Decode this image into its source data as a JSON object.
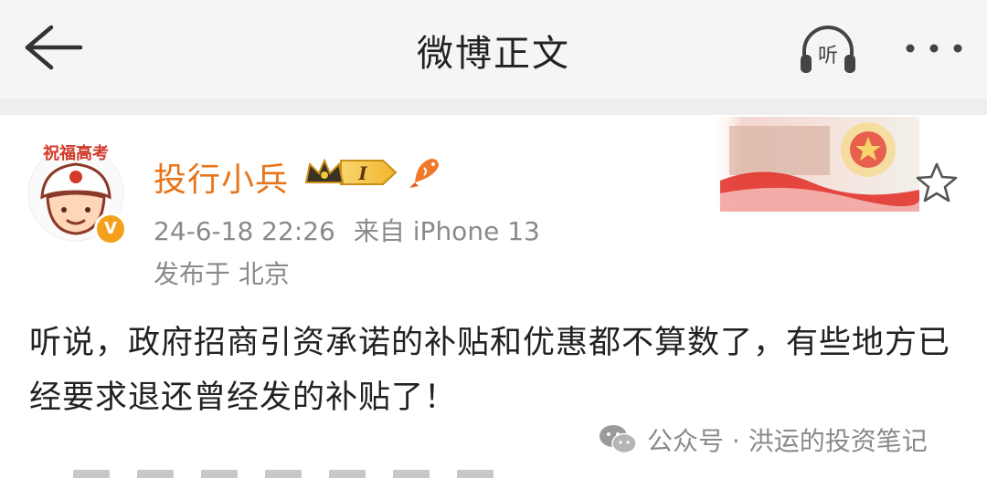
{
  "header": {
    "title": "微博正文",
    "listen_label": "听"
  },
  "post": {
    "author": {
      "name": "投行小兵",
      "avatar_caption": "祝福高考",
      "verified_badge": "V",
      "member_level": "I"
    },
    "timestamp": "24-6-18 22:26",
    "source": "来自 iPhone 13",
    "location": "发布于 北京",
    "content": "听说，政府招商引资承诺的补贴和优惠都不算数了，有些地方已经要求退还曾经发的补贴了！"
  },
  "watermark": {
    "text": "公众号 · 洪运的投资笔记"
  },
  "colors": {
    "username": "#e8741a",
    "meta": "#8a8a8a",
    "topbar_bg": "#f5f5f5",
    "badge_gold": "#f4a01c"
  },
  "icons": {
    "back": "back-arrow-icon",
    "listen": "headphones-icon",
    "more": "more-dots-icon",
    "star": "star-icon",
    "wechat": "wechat-icon"
  }
}
